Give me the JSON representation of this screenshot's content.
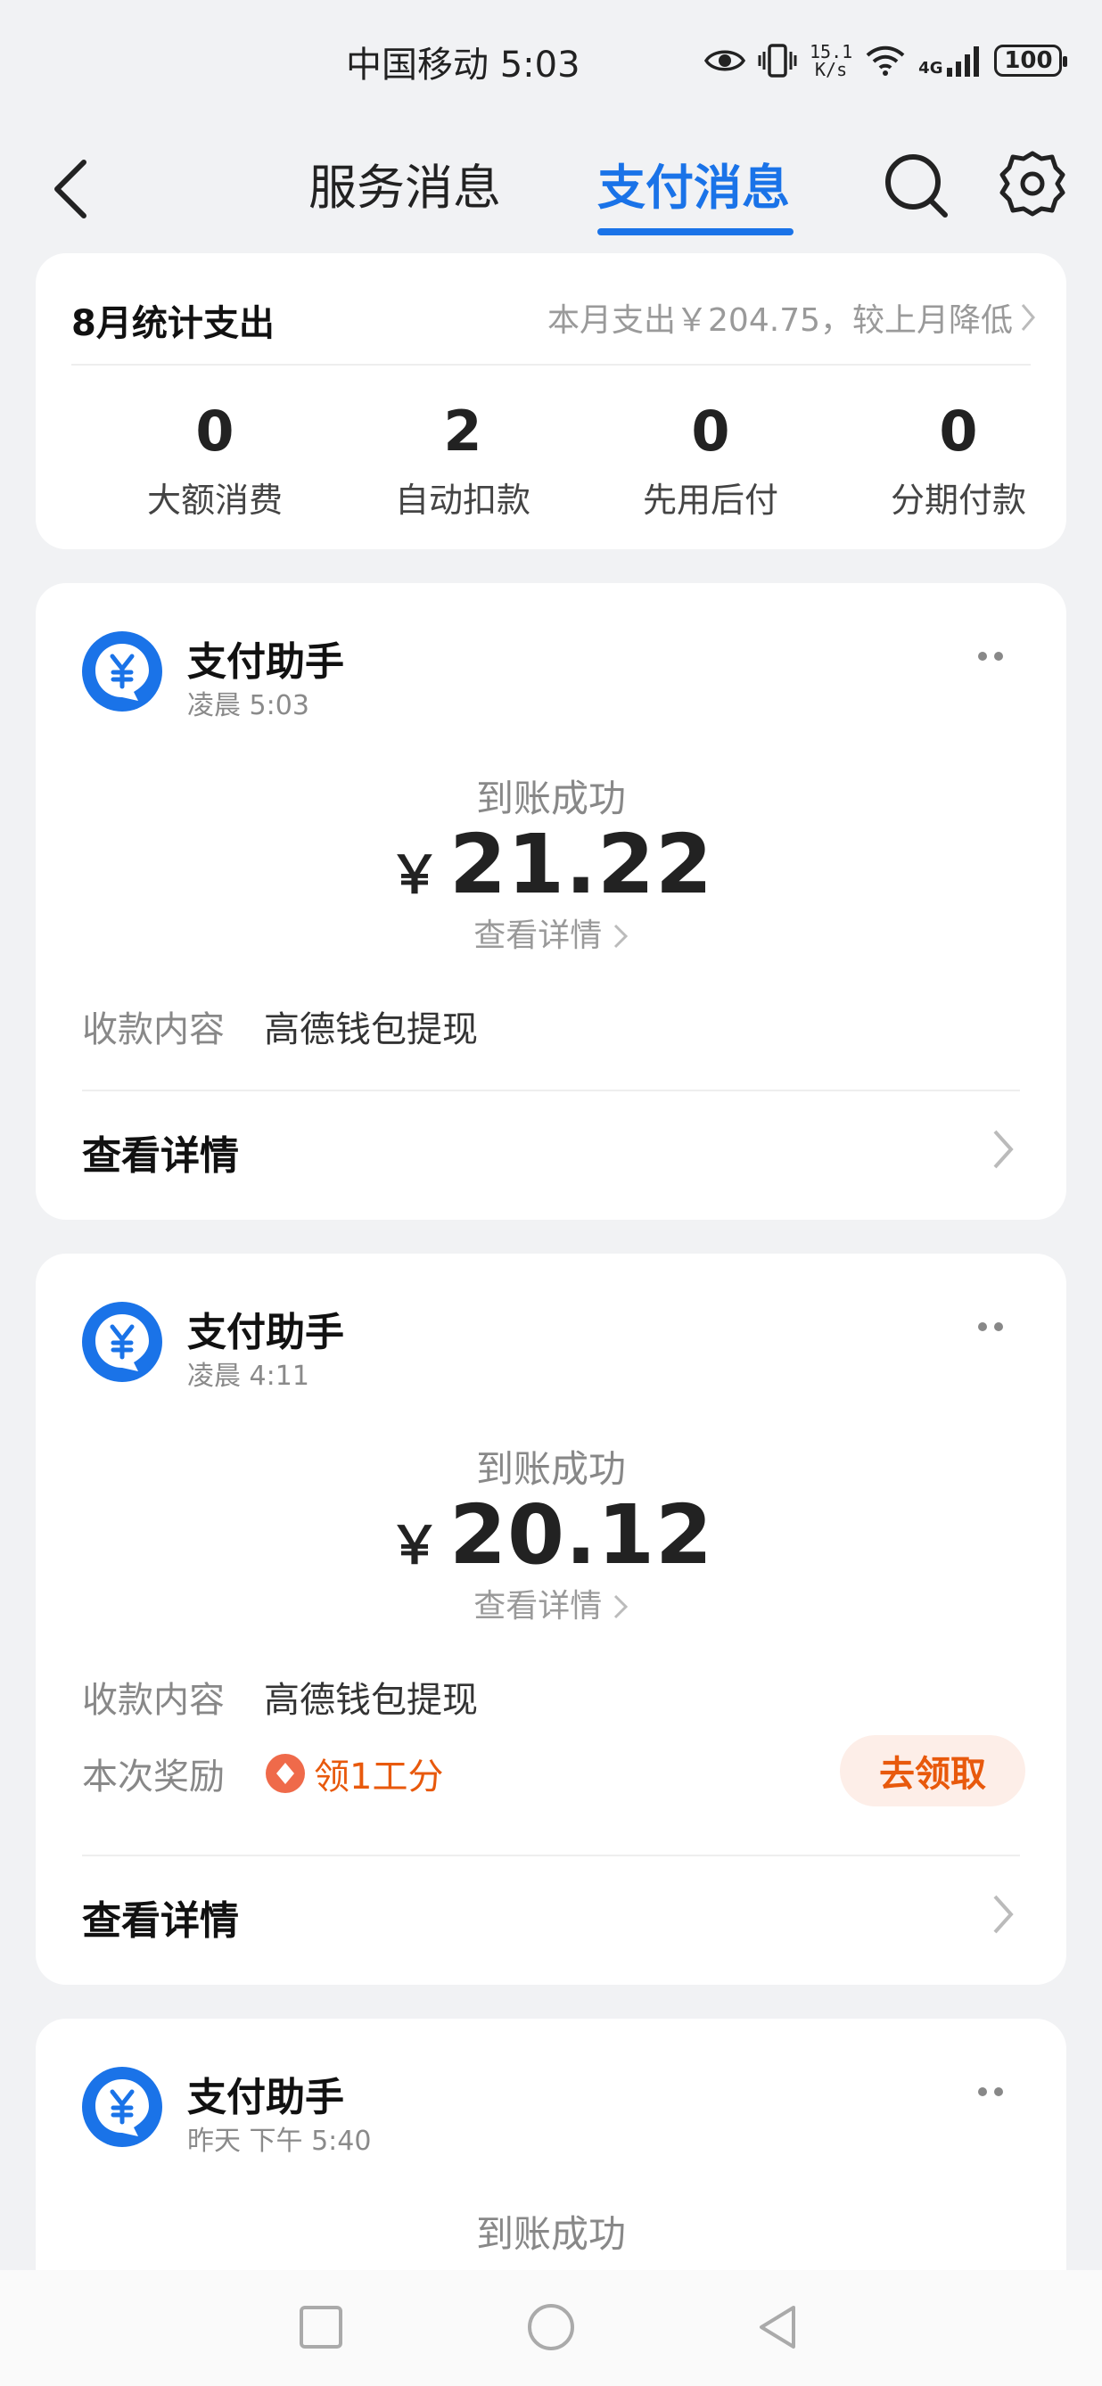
{
  "status_bar": {
    "carrier_time": "中国移动 5:03",
    "net_speed_top": "15.1",
    "net_speed_bottom": "K/s",
    "net_tech": "4G",
    "battery": "100"
  },
  "header": {
    "tabs": [
      {
        "label": "服务消息",
        "active": false
      },
      {
        "label": "支付消息",
        "active": true
      }
    ],
    "accent_color": "#1a73e8"
  },
  "summary": {
    "title": "8月统计支出",
    "link_text": "本月支出￥204.75，较上月降低",
    "stats": [
      {
        "value": "0",
        "label": "大额消费"
      },
      {
        "value": "2",
        "label": "自动扣款"
      },
      {
        "value": "0",
        "label": "先用后付"
      },
      {
        "value": "0",
        "label": "分期付款"
      }
    ]
  },
  "messages": [
    {
      "sender": "支付助手",
      "time": "凌晨 5:03",
      "status": "到账成功",
      "currency": "￥",
      "amount": "21.22",
      "detail_link": "查看详情",
      "content_label": "收款内容",
      "content_value": "高德钱包提现",
      "view_details": "查看详情"
    },
    {
      "sender": "支付助手",
      "time": "凌晨 4:11",
      "status": "到账成功",
      "currency": "￥",
      "amount": "20.12",
      "detail_link": "查看详情",
      "content_label": "收款内容",
      "content_value": "高德钱包提现",
      "reward_label": "本次奖励",
      "reward_value": "领1工分",
      "claim_button": "去领取",
      "view_details": "查看详情"
    },
    {
      "sender": "支付助手",
      "time": "昨天 下午 5:40",
      "status": "到账成功"
    }
  ],
  "icons": {
    "back": "chevron-left-icon",
    "search": "search-icon",
    "settings": "gear-icon",
    "avatar": "yuan-icon",
    "more": "more-dots-icon",
    "reward": "reward-diamond-icon"
  },
  "colors": {
    "reward_orange": "#e8590c",
    "avatar_blue": "#1a73e8"
  }
}
